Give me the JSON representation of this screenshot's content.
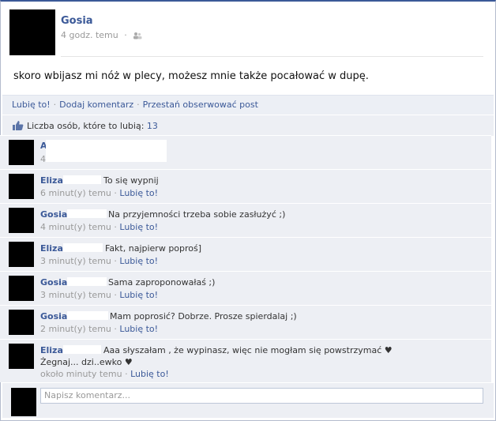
{
  "post": {
    "author": "Gosia",
    "time": "4 godz. temu",
    "privacy_icon": "people-icon",
    "text": "skoro wbijasz mi nóż w plecy, możesz mnie także pocałować w dupę."
  },
  "actions": {
    "like": "Lubię to!",
    "comment": "Dodaj komentarz",
    "unfollow": "Przestań obserwować post"
  },
  "likes": {
    "label": "Liczba osób, które to lubią:",
    "count": "13"
  },
  "comments": [
    {
      "name": "A",
      "text": "",
      "time": "4",
      "like": ""
    },
    {
      "name": "Eliza",
      "text": "To się wypnij",
      "time": "6 minut(y) temu",
      "like": "Lubię to!"
    },
    {
      "name": "Gosia",
      "text": "Na przyjemności trzeba sobie zasłużyć ;)",
      "time": "4 minut(y) temu",
      "like": "Lubię to!"
    },
    {
      "name": "Eliza",
      "text": "Fakt, najpierw poproś]",
      "time": "3 minut(y) temu",
      "like": "Lubię to!"
    },
    {
      "name": "Gosia",
      "text": "Sama zaproponowałaś ;)",
      "time": "3 minut(y) temu",
      "like": "Lubię to!"
    },
    {
      "name": "Gosia",
      "text": "Mam poprosić? Dobrze. Prosze spierdalaj ;)",
      "time": "2 minut(y) temu",
      "like": "Lubię to!"
    },
    {
      "name": "Eliza",
      "text": "Aaa słyszałam , że wypinasz, więc nie mogłam się powstrzymać ♥",
      "text2": "Żegnaj... dzi..ewko ♥",
      "time": "około minuty temu",
      "like": "Lubię to!"
    }
  ],
  "input": {
    "placeholder": "Napisz komentarz..."
  },
  "colors": {
    "link": "#3b5998",
    "panel": "#edeff4"
  }
}
